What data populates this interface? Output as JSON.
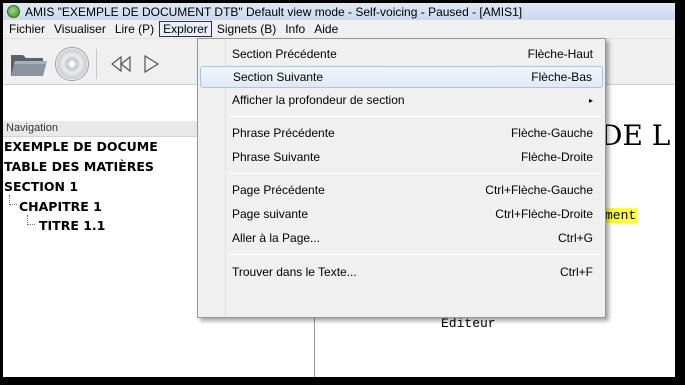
{
  "window": {
    "title": "AMIS \"EXEMPLE DE DOCUMENT DTB\" Default view mode - Self-voicing - Paused - [AMIS1]"
  },
  "menubar": {
    "items": [
      "Fichier",
      "Visualiser",
      "Lire (P)",
      "Explorer",
      "Signets (B)",
      "Info",
      "Aide"
    ],
    "active": "Explorer"
  },
  "navigation": {
    "label": "Navigation",
    "tree": [
      "EXEMPLE DE DOCUME",
      "TABLE DES MATIÈRES",
      "SECTION 1",
      "CHAPITRE 1",
      "TITRE 1.1"
    ]
  },
  "content": {
    "heading": "DE L",
    "highlight": "ment",
    "editeur": "Editeur"
  },
  "explorer_menu": {
    "items": [
      {
        "label": "Section Précédente",
        "shortcut": "Flèche-Haut"
      },
      {
        "label": "Section Suivante",
        "shortcut": "Flèche-Bas"
      },
      {
        "label": "Afficher la profondeur de section",
        "shortcut": "▸"
      },
      {
        "label": "Phrase Précédente",
        "shortcut": "Flèche-Gauche"
      },
      {
        "label": "Phrase Suivante",
        "shortcut": "Flèche-Droite"
      },
      {
        "label": "Page Précédente",
        "shortcut": "Ctrl+Flèche-Gauche"
      },
      {
        "label": "Page suivante",
        "shortcut": "Ctrl+Flèche-Droite"
      },
      {
        "label": "Aller à la Page...",
        "shortcut": "Ctrl+G"
      },
      {
        "label": "Trouver dans le Texte...",
        "shortcut": "Ctrl+F"
      }
    ],
    "hovered_index": 1
  },
  "colors": {
    "highlight": "#ffff33",
    "menu_hover_border": "#a9c6ea"
  },
  "icons": [
    "app-icon",
    "open-folder-icon",
    "cd-icon",
    "rewind-icon",
    "play-icon"
  ]
}
